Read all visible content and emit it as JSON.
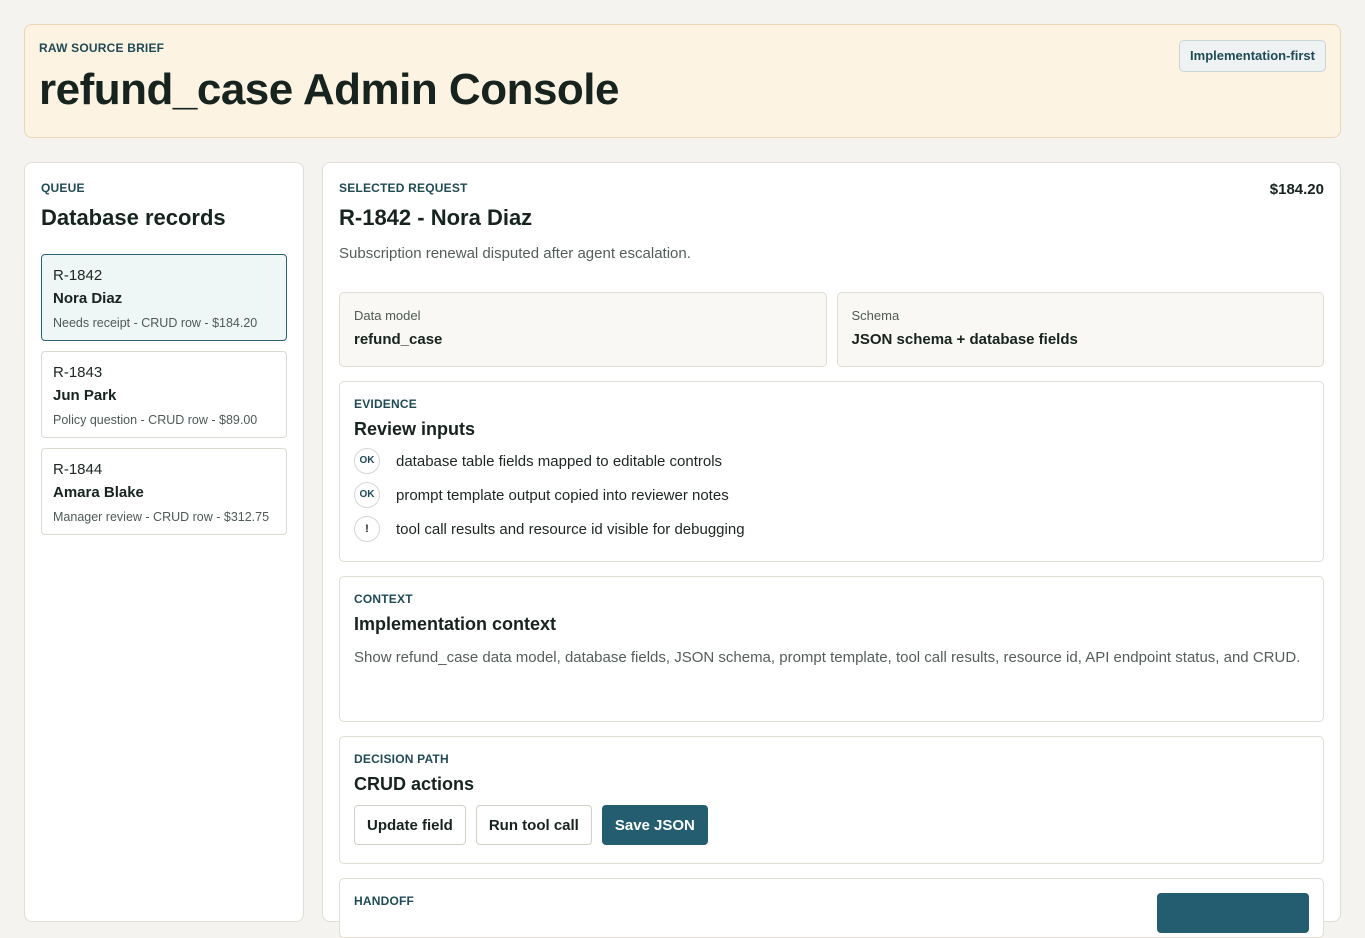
{
  "header": {
    "eyebrow": "RAW SOURCE BRIEF",
    "title": "refund_case Admin Console",
    "badge": "Implementation-first"
  },
  "queue": {
    "eyebrow": "QUEUE",
    "title": "Database records",
    "records": [
      {
        "id": "R-1842",
        "name": "Nora Diaz",
        "meta": "Needs receipt - CRUD row - $184.20",
        "selected": true
      },
      {
        "id": "R-1843",
        "name": "Jun Park",
        "meta": "Policy question - CRUD row - $89.00",
        "selected": false
      },
      {
        "id": "R-1844",
        "name": "Amara Blake",
        "meta": "Manager review - CRUD row - $312.75",
        "selected": false
      }
    ]
  },
  "detail": {
    "eyebrow": "SELECTED REQUEST",
    "amount": "$184.20",
    "title": "R-1842 - Nora Diaz",
    "summary": "Subscription renewal disputed after agent escalation.",
    "fields": [
      {
        "label": "Data model",
        "value": "refund_case"
      },
      {
        "label": "Schema",
        "value": "JSON schema + database fields"
      }
    ],
    "evidence": {
      "eyebrow": "EVIDENCE",
      "title": "Review inputs",
      "items": [
        {
          "badge": "OK",
          "text": "database table fields mapped to editable controls"
        },
        {
          "badge": "OK",
          "text": "prompt template output copied into reviewer notes"
        },
        {
          "badge": "!",
          "text": "tool call results and resource id visible for debugging"
        }
      ]
    },
    "context": {
      "eyebrow": "CONTEXT",
      "title": "Implementation context",
      "body": "Show refund_case data model, database fields, JSON schema, prompt template, tool call results, resource id, API endpoint status, and CRUD."
    },
    "decision": {
      "eyebrow": "DECISION PATH",
      "title": "CRUD actions",
      "buttons": {
        "update": "Update field",
        "run": "Run tool call",
        "save": "Save JSON"
      }
    },
    "handoff": {
      "eyebrow": "HANDOFF"
    }
  }
}
